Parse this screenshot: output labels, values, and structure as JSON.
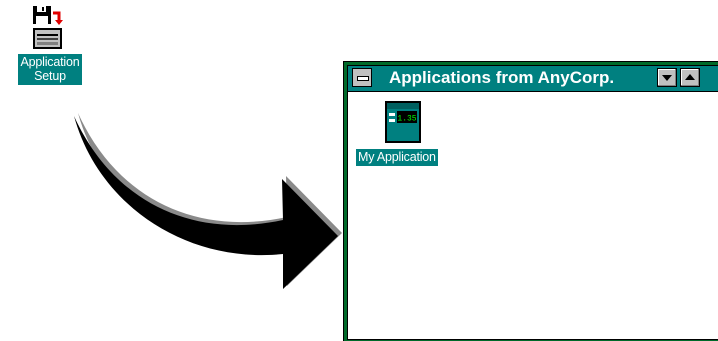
{
  "desktop": {
    "setup_icon": {
      "icon": "floppy-install-icon",
      "label_line1": "Application",
      "label_line2": "Setup"
    }
  },
  "group_window": {
    "title": "Applications from AnyCorp.",
    "program_items": [
      {
        "label": "My Application",
        "icon": "application-window-icon",
        "icon_readout": "1.35"
      }
    ]
  },
  "colors": {
    "title_bar": "#008080",
    "window_frame": "#006a2a",
    "label_highlight": "#008080",
    "arrow": "#000000",
    "arrow_shadow": "#8a8a8a"
  }
}
